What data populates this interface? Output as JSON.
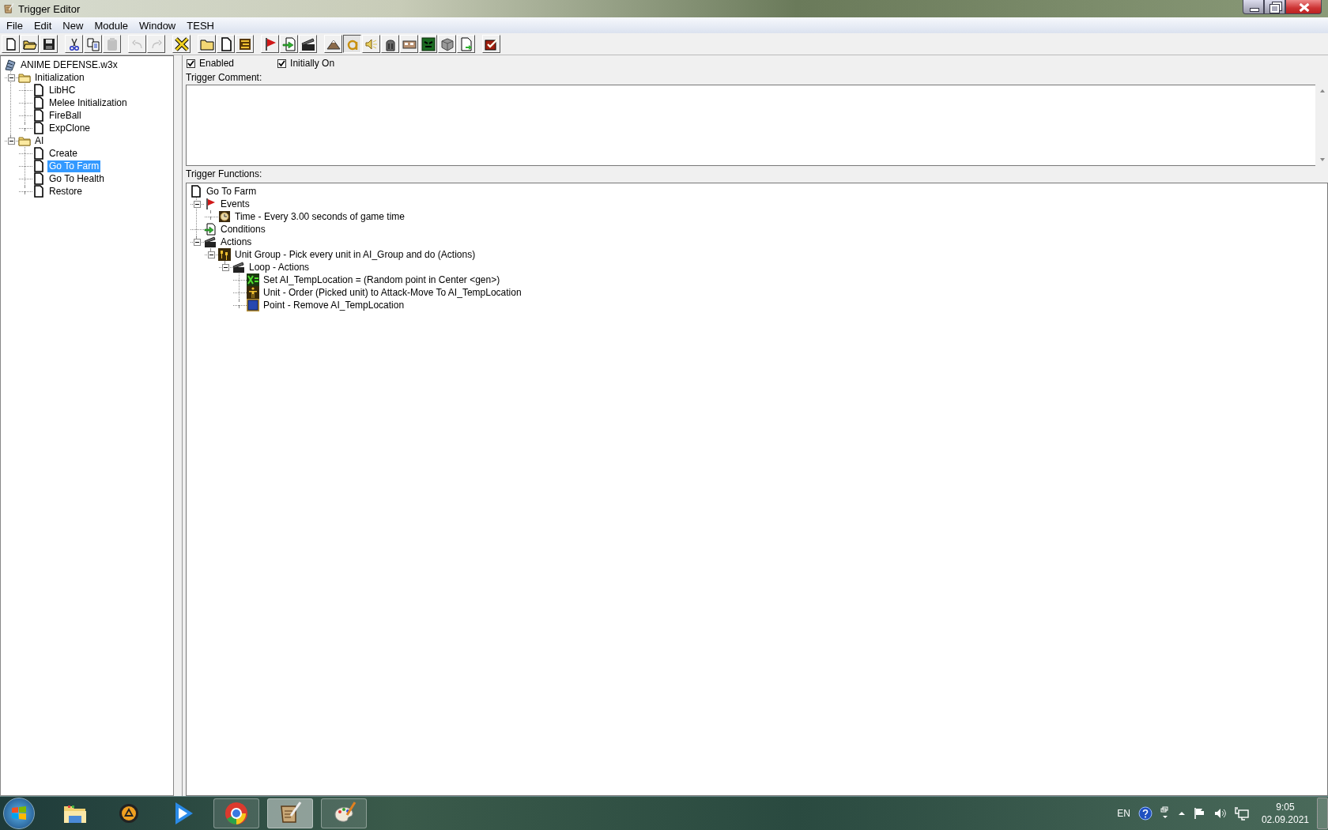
{
  "window": {
    "title": "Trigger Editor"
  },
  "menu": [
    "File",
    "Edit",
    "New",
    "Module",
    "Window",
    "TESH"
  ],
  "toolbar": [
    [
      {
        "kind": "new",
        "disabled": false,
        "pressed": false
      },
      {
        "kind": "open",
        "disabled": false,
        "pressed": false
      },
      {
        "kind": "save",
        "disabled": false,
        "pressed": false
      }
    ],
    [
      {
        "kind": "cut",
        "disabled": false,
        "pressed": false
      },
      {
        "kind": "copy",
        "disabled": false,
        "pressed": false
      },
      {
        "kind": "paste",
        "disabled": true,
        "pressed": false
      }
    ],
    [
      {
        "kind": "undo",
        "disabled": true,
        "pressed": false
      },
      {
        "kind": "redo",
        "disabled": true,
        "pressed": false
      }
    ],
    [
      {
        "kind": "delete",
        "disabled": false,
        "pressed": false
      }
    ],
    [
      {
        "kind": "folder",
        "disabled": false,
        "pressed": false
      },
      {
        "kind": "page",
        "disabled": false,
        "pressed": false
      },
      {
        "kind": "list",
        "disabled": false,
        "pressed": false
      }
    ],
    [
      {
        "kind": "flag",
        "disabled": false,
        "pressed": false
      },
      {
        "kind": "condition",
        "disabled": false,
        "pressed": false
      },
      {
        "kind": "clapper",
        "disabled": false,
        "pressed": false
      }
    ],
    [
      {
        "kind": "terrain",
        "disabled": false,
        "pressed": false
      },
      {
        "kind": "letter",
        "disabled": false,
        "pressed": true
      },
      {
        "kind": "sound",
        "disabled": false,
        "pressed": false
      },
      {
        "kind": "helmet",
        "disabled": false,
        "pressed": false
      },
      {
        "kind": "panel",
        "disabled": false,
        "pressed": false
      },
      {
        "kind": "monster",
        "disabled": false,
        "pressed": false
      },
      {
        "kind": "cube",
        "disabled": false,
        "pressed": false
      },
      {
        "kind": "import",
        "disabled": false,
        "pressed": false
      }
    ],
    [
      {
        "kind": "check",
        "disabled": false,
        "pressed": false
      }
    ]
  ],
  "project_tree": {
    "label": "ANIME DEFENSE.w3x",
    "children": [
      {
        "label": "Initialization",
        "kind": "category",
        "expanded": true,
        "selected": false,
        "children": [
          {
            "label": "LibHC",
            "kind": "trigger",
            "selected": false
          },
          {
            "label": "Melee Initialization",
            "kind": "trigger",
            "selected": false
          },
          {
            "label": "FireBall",
            "kind": "trigger",
            "selected": false
          },
          {
            "label": "ExpClone",
            "kind": "trigger",
            "selected": false
          }
        ]
      },
      {
        "label": "AI",
        "kind": "category",
        "expanded": true,
        "selected": false,
        "children": [
          {
            "label": "Create",
            "kind": "trigger",
            "selected": false
          },
          {
            "label": "Go To Farm",
            "kind": "trigger",
            "selected": true
          },
          {
            "label": "Go To Health",
            "kind": "trigger",
            "selected": false
          },
          {
            "label": "Restore",
            "kind": "trigger",
            "selected": false
          }
        ]
      }
    ]
  },
  "options": [
    {
      "label": "Enabled",
      "checked": true
    },
    {
      "label": "Initially On",
      "checked": true
    }
  ],
  "comment": {
    "label": "Trigger Comment:"
  },
  "functions": {
    "label": "Trigger Functions:",
    "tree": {
      "label": "Go To Farm",
      "kind": "trigger",
      "children": [
        {
          "label": "Events",
          "kind": "events",
          "expanded": true,
          "children": [
            {
              "label": "Time - Every 3.00 seconds of game time",
              "kind": "timer"
            }
          ]
        },
        {
          "label": "Conditions",
          "kind": "conditions"
        },
        {
          "label": "Actions",
          "kind": "actions",
          "expanded": true,
          "children": [
            {
              "label": "Unit Group - Pick every unit in AI_Group and do (Actions)",
              "kind": "unit-group",
              "expanded": true,
              "children": [
                {
                  "label": "Loop - Actions",
                  "kind": "actions",
                  "expanded": true,
                  "children": [
                    {
                      "label": "Set AI_TempLocation = (Random point in Center <gen>)",
                      "kind": "set-variable"
                    },
                    {
                      "label": "Unit - Order (Picked unit) to Attack-Move To AI_TempLocation",
                      "kind": "unit"
                    },
                    {
                      "label": "Point - Remove AI_TempLocation",
                      "kind": "point"
                    }
                  ]
                }
              ]
            }
          ]
        }
      ]
    }
  },
  "taskbar": {
    "apps": [
      {
        "kind": "explorer",
        "open": false,
        "active": false
      },
      {
        "kind": "player",
        "open": false,
        "active": false
      },
      {
        "kind": "play",
        "open": false,
        "active": false
      },
      {
        "kind": "browser",
        "open": true,
        "active": false
      },
      {
        "kind": "editor",
        "open": true,
        "active": true
      },
      {
        "kind": "paint",
        "open": true,
        "active": false
      }
    ],
    "language": "EN",
    "time": "9:05",
    "date": "02.09.2021"
  }
}
